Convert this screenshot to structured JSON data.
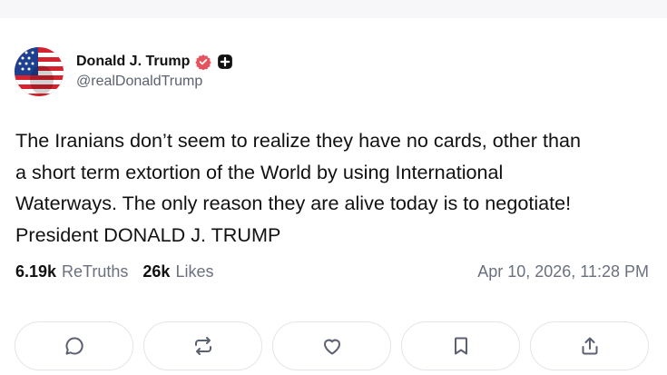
{
  "post": {
    "author": {
      "display_name": "Donald J. Trump",
      "handle": "@realDonaldTrump",
      "verified_icon": "verified-badge-icon",
      "platform_icon": "truth-plus-icon",
      "avatar_colors": {
        "red": "#d4232f",
        "white": "#ffffff",
        "blue": "#1c3f8f"
      }
    },
    "text_lines": [
      "The Iranians don’t seem to realize they have no cards, other than",
      "a short term extortion of the World by using International",
      "Waterways. The only reason they are alive today is to negotiate!",
      "President DONALD J. TRUMP"
    ],
    "stats": {
      "retruths_count": "6.19k",
      "retruths_label": "ReTruths",
      "likes_count": "26k",
      "likes_label": "Likes"
    },
    "timestamp": "Apr 10, 2026, 11:28 PM"
  },
  "actions": [
    {
      "name": "reply",
      "icon": "reply-icon"
    },
    {
      "name": "retruth",
      "icon": "retruth-icon"
    },
    {
      "name": "like",
      "icon": "heart-icon"
    },
    {
      "name": "bookmark",
      "icon": "bookmark-icon"
    },
    {
      "name": "share",
      "icon": "share-icon"
    }
  ],
  "colors": {
    "verified": "#e5535f",
    "muted_text": "#6b7080",
    "border": "#e4e5ea"
  }
}
